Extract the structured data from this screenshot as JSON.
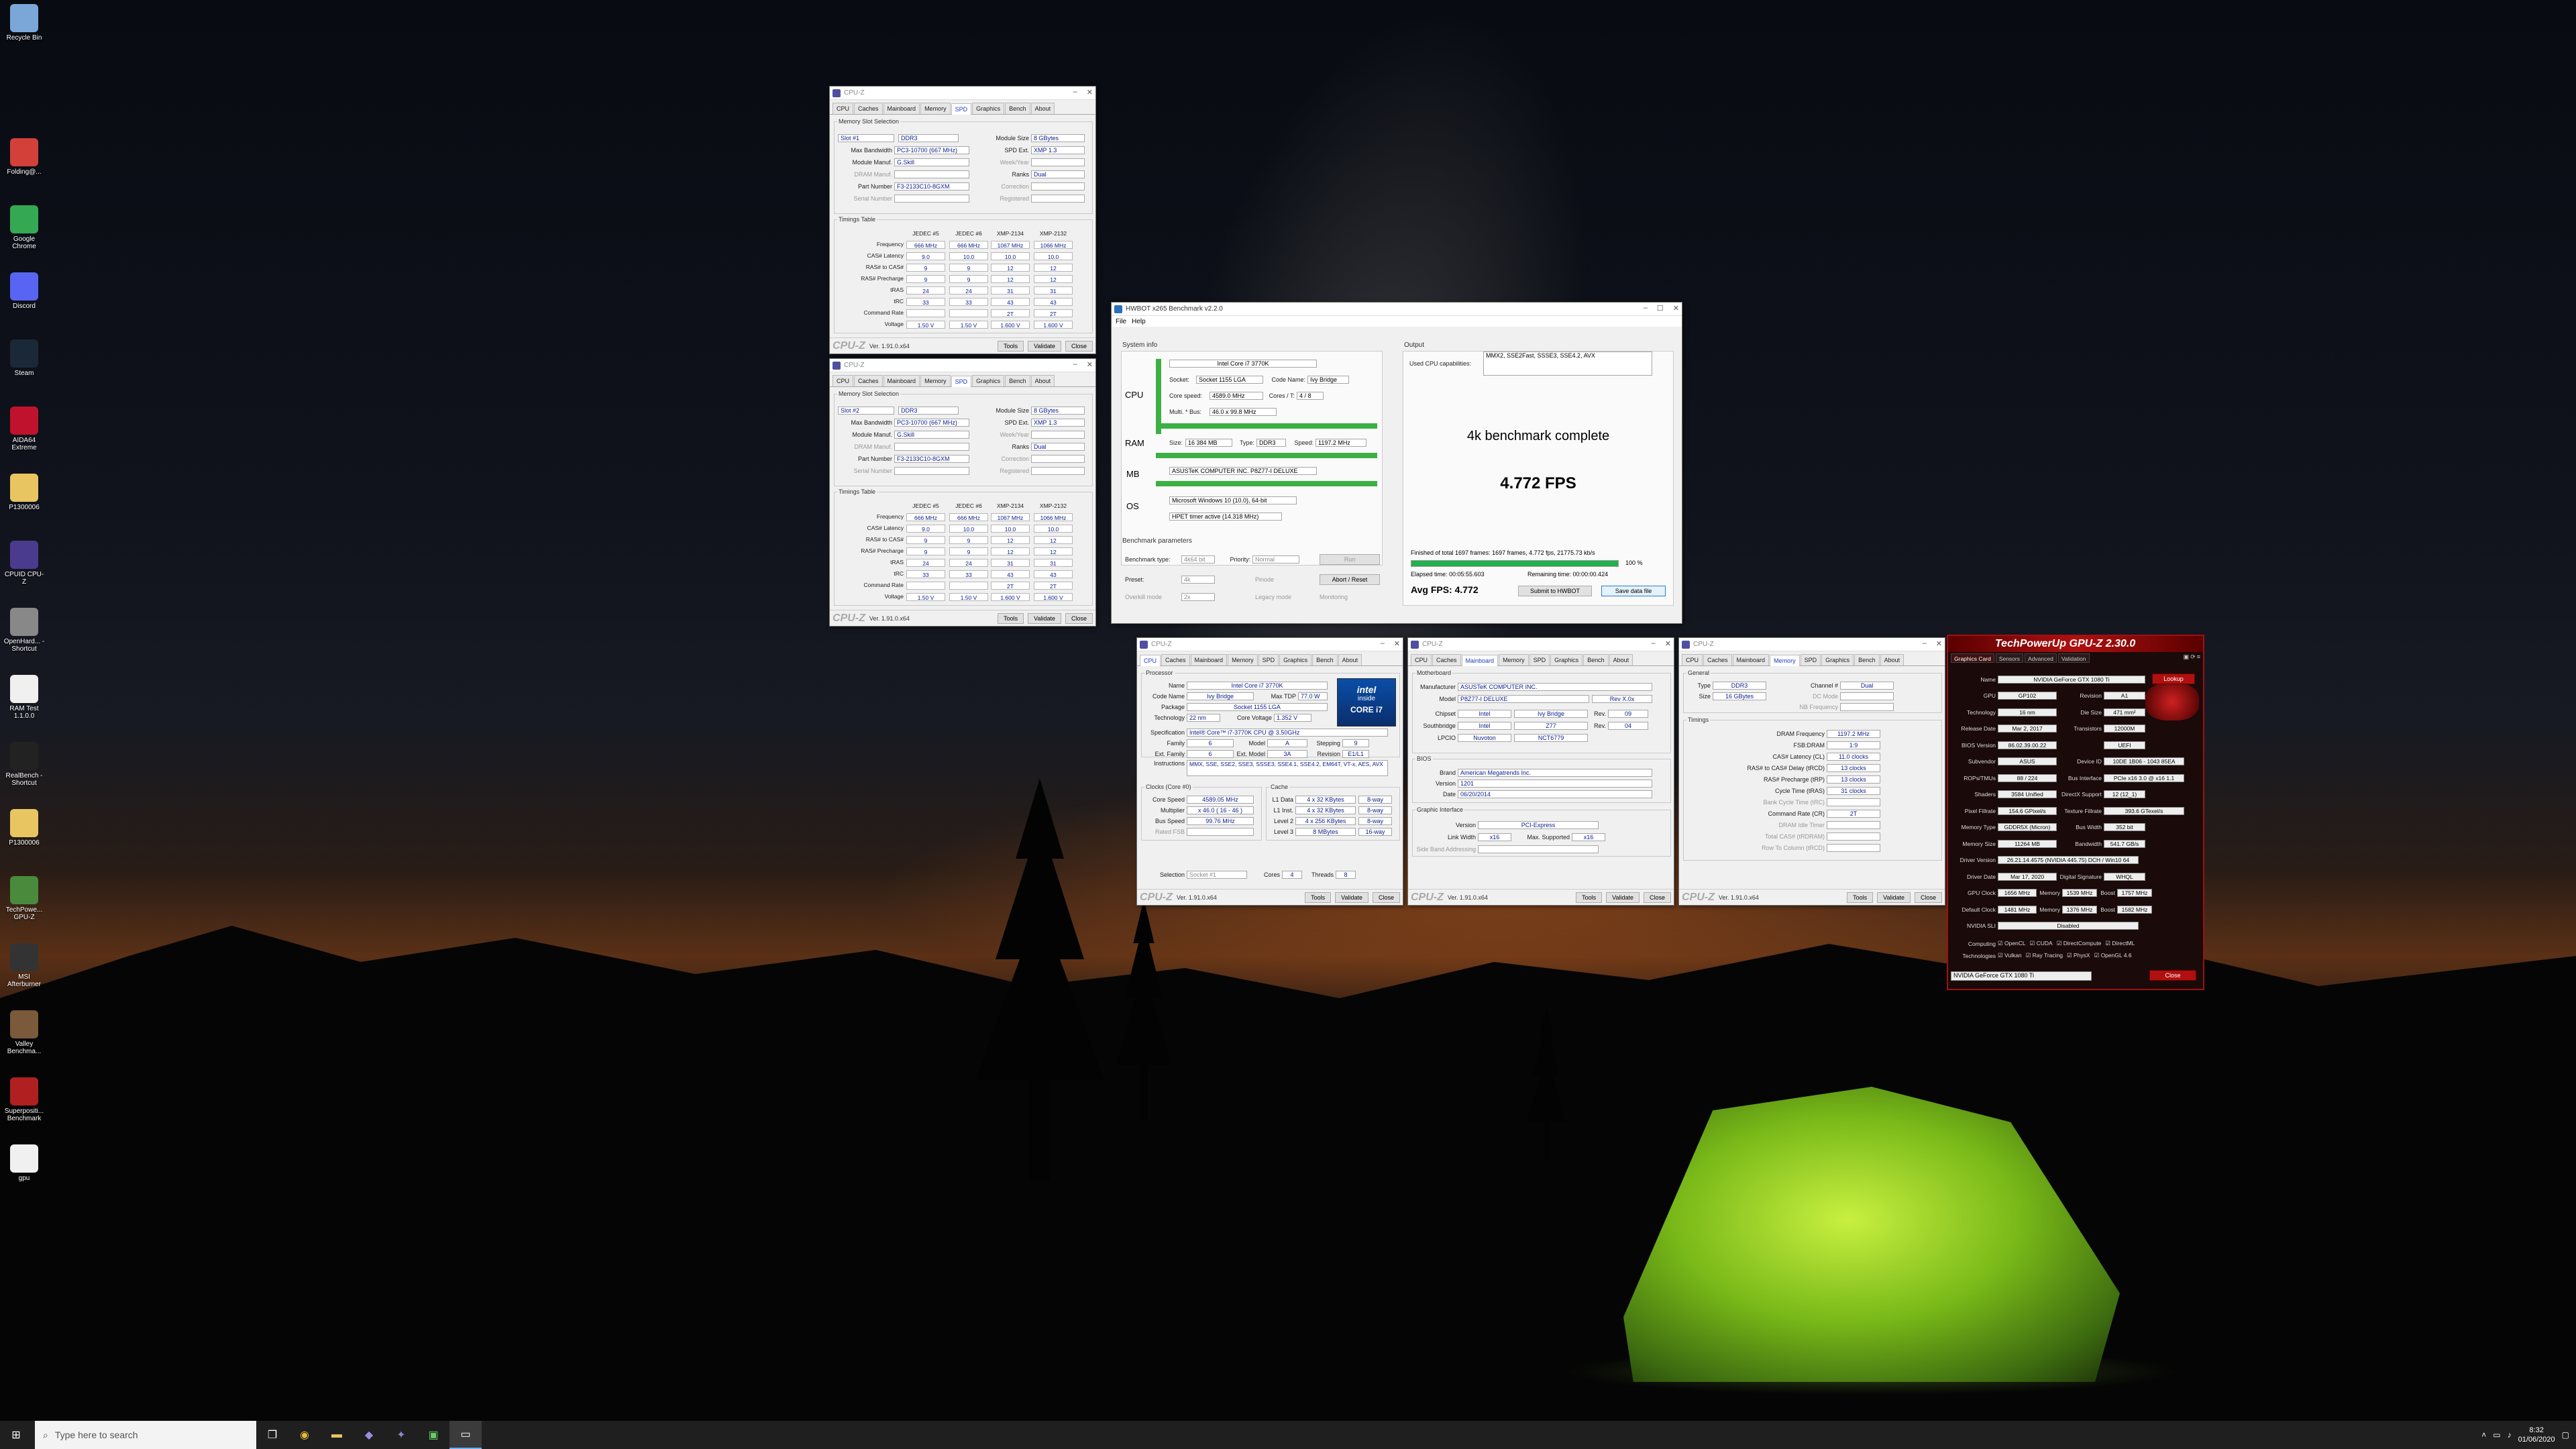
{
  "desktop": {
    "icons": [
      {
        "label": "Recycle Bin",
        "icon": "recycle-bin-icon",
        "color": "#7aa7d8"
      },
      {
        "label": "Folding@...",
        "icon": "folding-icon",
        "color": "#d2403a"
      },
      {
        "label": "Google Chrome",
        "icon": "chrome-icon",
        "color": "#34a853"
      },
      {
        "label": "Discord",
        "icon": "discord-icon",
        "color": "#5865f2"
      },
      {
        "label": "Steam",
        "icon": "steam-icon",
        "color": "#1b2838"
      },
      {
        "label": "AIDA64 Extreme",
        "icon": "aida64-icon",
        "color": "#c0122d"
      },
      {
        "label": "P1300006",
        "icon": "folder-icon",
        "color": "#e8c560"
      },
      {
        "label": "CPUID CPU-Z",
        "icon": "cpuz-icon",
        "color": "#4b3b8f"
      },
      {
        "label": "OpenHard... - Shortcut",
        "icon": "openhardware-icon",
        "color": "#888888"
      },
      {
        "label": "RAM Test 1.1.0.0",
        "icon": "document-icon",
        "color": "#f0f0f0"
      },
      {
        "label": "RealBench - Shortcut",
        "icon": "realbench-icon",
        "color": "#222222"
      },
      {
        "label": "P1300006",
        "icon": "folder-icon",
        "color": "#e8c560"
      },
      {
        "label": "TechPowe... GPU-Z",
        "icon": "gpuz-icon",
        "color": "#4a8a3c"
      },
      {
        "label": "MSI Afterburner",
        "icon": "afterburner-icon",
        "color": "#333333"
      },
      {
        "label": "Valley Benchma...",
        "icon": "valley-icon",
        "color": "#7a5a3a"
      },
      {
        "label": "Superpositi... Benchmark",
        "icon": "superposition-icon",
        "color": "#b02020"
      },
      {
        "label": "gpu",
        "icon": "document-icon",
        "color": "#f0f0f0"
      }
    ]
  },
  "cpuz_spd1": {
    "title": "CPU-Z",
    "tabs": [
      "CPU",
      "Caches",
      "Mainboard",
      "Memory",
      "SPD",
      "Graphics",
      "Bench",
      "About"
    ],
    "active_tab": "SPD",
    "slot_group": "Memory Slot Selection",
    "slot": "Slot #1",
    "type": "DDR3",
    "module_size_label": "Module Size",
    "module_size": "8 GBytes",
    "max_bw_label": "Max Bandwidth",
    "max_bw": "PC3-10700 (667 MHz)",
    "spd_ext_label": "SPD Ext.",
    "spd_ext": "XMP 1.3",
    "manuf_label": "Module Manuf.",
    "manuf": "G.Skill",
    "weekyear_label": "Week/Year",
    "dram_manuf_label": "DRAM Manuf.",
    "ranks_label": "Ranks",
    "ranks": "Dual",
    "part_label": "Part Number",
    "part": "F3-2133C10-8GXM",
    "correction_label": "Correction",
    "serial_label": "Serial Number",
    "registered_label": "Registered",
    "timings_group": "Timings Table",
    "cols": [
      "JEDEC #5",
      "JEDEC #6",
      "XMP-2134",
      "XMP-2132"
    ],
    "rows": [
      {
        "label": "Frequency",
        "vals": [
          "666 MHz",
          "666 MHz",
          "1067 MHz",
          "1066 MHz"
        ]
      },
      {
        "label": "CAS# Latency",
        "vals": [
          "9.0",
          "10.0",
          "10.0",
          "10.0"
        ]
      },
      {
        "label": "RAS# to CAS#",
        "vals": [
          "9",
          "9",
          "12",
          "12"
        ]
      },
      {
        "label": "RAS# Precharge",
        "vals": [
          "9",
          "9",
          "12",
          "12"
        ]
      },
      {
        "label": "tRAS",
        "vals": [
          "24",
          "24",
          "31",
          "31"
        ]
      },
      {
        "label": "tRC",
        "vals": [
          "33",
          "33",
          "43",
          "43"
        ]
      },
      {
        "label": "Command Rate",
        "vals": [
          "",
          "",
          "2T",
          "2T"
        ]
      },
      {
        "label": "Voltage",
        "vals": [
          "1.50 V",
          "1.50 V",
          "1.600 V",
          "1.600 V"
        ]
      }
    ],
    "brand": "CPU-Z",
    "version": "Ver. 1.91.0.x64",
    "tools": "Tools",
    "validate": "Validate",
    "close": "Close"
  },
  "cpuz_spd2": {
    "title": "CPU-Z",
    "tabs": [
      "CPU",
      "Caches",
      "Mainboard",
      "Memory",
      "SPD",
      "Graphics",
      "Bench",
      "About"
    ],
    "slot_group": "Memory Slot Selection",
    "slot": "Slot #2",
    "type": "DDR3",
    "module_size_label": "Module Size",
    "module_size": "8 GBytes",
    "max_bw_label": "Max Bandwidth",
    "max_bw": "PC3-10700 (667 MHz)",
    "spd_ext_label": "SPD Ext.",
    "spd_ext": "XMP 1.3",
    "manuf_label": "Module Manuf.",
    "manuf": "G.Skill",
    "weekyear_label": "Week/Year",
    "dram_manuf_label": "DRAM Manuf.",
    "ranks_label": "Ranks",
    "ranks": "Dual",
    "part_label": "Part Number",
    "part": "F3-2133C10-8GXM",
    "correction_label": "Correction",
    "serial_label": "Serial Number",
    "registered_label": "Registered",
    "timings_group": "Timings Table",
    "cols": [
      "JEDEC #5",
      "JEDEC #6",
      "XMP-2134",
      "XMP-2132"
    ],
    "rows": [
      {
        "label": "Frequency",
        "vals": [
          "666 MHz",
          "666 MHz",
          "1067 MHz",
          "1066 MHz"
        ]
      },
      {
        "label": "CAS# Latency",
        "vals": [
          "9.0",
          "10.0",
          "10.0",
          "10.0"
        ]
      },
      {
        "label": "RAS# to CAS#",
        "vals": [
          "9",
          "9",
          "12",
          "12"
        ]
      },
      {
        "label": "RAS# Precharge",
        "vals": [
          "9",
          "9",
          "12",
          "12"
        ]
      },
      {
        "label": "tRAS",
        "vals": [
          "24",
          "24",
          "31",
          "31"
        ]
      },
      {
        "label": "tRC",
        "vals": [
          "33",
          "33",
          "43",
          "43"
        ]
      },
      {
        "label": "Command Rate",
        "vals": [
          "",
          "",
          "2T",
          "2T"
        ]
      },
      {
        "label": "Voltage",
        "vals": [
          "1.50 V",
          "1.50 V",
          "1.600 V",
          "1.600 V"
        ]
      }
    ],
    "brand": "CPU-Z",
    "version": "Ver. 1.91.0.x64",
    "tools": "Tools",
    "validate": "Validate",
    "close": "Close"
  },
  "hwbot": {
    "title": "HWBOT x265 Benchmark v2.2.0",
    "menu": [
      "File",
      "Help"
    ],
    "sysinfo_label": "System info",
    "cpu_name": "Intel Core i7 3770K",
    "socket_label": "Socket:",
    "socket": "Socket 1155 LGA",
    "codename_label": "Code Name:",
    "codename": "Ivy Bridge",
    "corespeed_label": "Core speed:",
    "corespeed": "4589.0 MHz",
    "cores_label": "Cores / T:",
    "cores": "4 / 8",
    "mult_label": "Multi. * Bus:",
    "mult": "46.0 x 99.8 MHz",
    "cpu_tag": "CPU",
    "ram_tag": "RAM",
    "mb_tag": "MB",
    "os_tag": "OS",
    "ram_size_label": "Size:",
    "ram_size": "16 384 MB",
    "ram_type_label": "Type:",
    "ram_type": "DDR3",
    "ram_speed_label": "Speed:",
    "ram_speed": "1197.2 MHz",
    "mb": "ASUSTeK COMPUTER INC. P8Z77-I DELUXE",
    "os": "Microsoft Windows 10 (10.0), 64-bit",
    "timer": "HPET timer active (14.318 MHz)",
    "bench_params_label": "Benchmark parameters",
    "bench_type_label": "Benchmark type:",
    "bench_type": "4k64 bit",
    "priority_label": "Priority:",
    "priority": "Normal",
    "run_label": "Run",
    "preset_label": "Preset:",
    "preset": "4k",
    "pinode_label": "Pinode",
    "abort_label": "Abort / Reset",
    "overkill_label": "Overkill mode",
    "overkill_val": "2x",
    "legacy_label": "Legacy mode",
    "monitoring_label": "Monitoring",
    "output_label": "Output",
    "capabilities_label": "Used CPU capabilities:",
    "capabilities": "MMX2, SSE2Fast, SSSE3, SSE4.2, AVX",
    "complete": "4k benchmark complete",
    "fps": "4.772 FPS",
    "finished": "Finished of total 1697 frames: 1697 frames, 4.772 fps, 21775.73 kb/s",
    "percent": "100 %",
    "progress": 1.0,
    "elapsed": "Elapsed time: 00:05:55.603",
    "remaining": "Remaining time: 00:00:00.424",
    "avg": "Avg FPS: 4.772",
    "submit": "Submit to HWBOT",
    "save": "Save data file"
  },
  "cpuz_cpu": {
    "title": "CPU-Z",
    "tabs": [
      "CPU",
      "Caches",
      "Mainboard",
      "Memory",
      "SPD",
      "Graphics",
      "Bench",
      "About"
    ],
    "processor_group": "Processor",
    "name_label": "Name",
    "name": "Intel Core i7 3770K",
    "codename_label": "Code Name",
    "codename": "Ivy Bridge",
    "maxtdp_label": "Max TDP",
    "maxtdp": "77.0 W",
    "package_label": "Package",
    "package": "Socket 1155 LGA",
    "tech_label": "Technology",
    "tech": "22 nm",
    "corev_label": "Core Voltage",
    "corev": "1.352 V",
    "spec_label": "Specification",
    "spec": "Intel® Core™ i7-3770K CPU @ 3.50GHz",
    "family_label": "Family",
    "family": "6",
    "model_label": "Model",
    "model": "A",
    "stepping_label": "Stepping",
    "stepping": "9",
    "extfamily_label": "Ext. Family",
    "extfamily": "6",
    "extmodel_label": "Ext. Model",
    "extmodel": "3A",
    "revision_label": "Revision",
    "revision": "E1/L1",
    "instr_label": "Instructions",
    "instr": "MMX, SSE, SSE2, SSE3, SSSE3, SSE4.1, SSE4.2, EM64T, VT-x, AES, AVX",
    "clocks_group": "Clocks (Core #0)",
    "corespeed_label": "Core Speed",
    "corespeed": "4589.05 MHz",
    "mult_label": "Multiplier",
    "mult": "x 46.0 ( 16 - 46 )",
    "bus_label": "Bus Speed",
    "bus": "99.76 MHz",
    "fsb_label": "Rated FSB",
    "cache_group": "Cache",
    "l1d_label": "L1 Data",
    "l1d": "4 x 32 KBytes",
    "l1d_way": "8-way",
    "l1i_label": "L1 Inst.",
    "l1i": "4 x 32 KBytes",
    "l1i_way": "8-way",
    "l2_label": "Level 2",
    "l2": "4 x 256 KBytes",
    "l2_way": "8-way",
    "l3_label": "Level 3",
    "l3": "8 MBytes",
    "l3_way": "16-way",
    "selection_label": "Selection",
    "selection": "Socket #1",
    "cores_label": "Cores",
    "cores": "4",
    "threads_label": "Threads",
    "threads": "8",
    "intel_badge_top": "intel",
    "intel_badge_mid": "inside",
    "intel_badge_bottom": "CORE i7",
    "brand": "CPU-Z",
    "version": "Ver. 1.91.0.x64",
    "tools": "Tools",
    "validate": "Validate",
    "close": "Close"
  },
  "cpuz_mb": {
    "title": "CPU-Z",
    "tabs": [
      "CPU",
      "Caches",
      "Mainboard",
      "Memory",
      "SPD",
      "Graphics",
      "Bench",
      "About"
    ],
    "mb_group": "Motherboard",
    "manuf_label": "Manufacturer",
    "manuf": "ASUSTeK COMPUTER INC.",
    "model_label": "Model",
    "model": "P8Z77-I DELUXE",
    "model_rev": "Rev X.0x",
    "chipset_label": "Chipset",
    "chipset": "Intel",
    "chipset_name": "Ivy Bridge",
    "chipset_rev_label": "Rev.",
    "chipset_rev": "09",
    "south_label": "Southbridge",
    "south": "Intel",
    "south_name": "Z77",
    "south_rev_label": "Rev.",
    "south_rev": "04",
    "lpcio_label": "LPCIO",
    "lpcio": "Nuvoton",
    "lpcio_name": "NCT6779",
    "bios_group": "BIOS",
    "brand_label": "Brand",
    "brand_val": "American Megatrends Inc.",
    "version_label": "Version",
    "version_val": "1201",
    "date_label": "Date",
    "date_val": "06/20/2014",
    "gi_group": "Graphic Interface",
    "gi_version_label": "Version",
    "gi_version": "PCI-Express",
    "linkwidth_label": "Link Width",
    "linkwidth": "x16",
    "maxsupp_label": "Max. Supported",
    "maxsupp": "x16",
    "sideband_label": "Side Band Addressing",
    "brand": "CPU-Z",
    "version": "Ver. 1.91.0.x64",
    "tools": "Tools",
    "validate": "Validate",
    "close": "Close"
  },
  "cpuz_mem": {
    "title": "CPU-Z",
    "tabs": [
      "CPU",
      "Caches",
      "Mainboard",
      "Memory",
      "SPD",
      "Graphics",
      "Bench",
      "About"
    ],
    "general_group": "General",
    "type_label": "Type",
    "type": "DDR3",
    "channel_label": "Channel #",
    "channel": "Dual",
    "size_label": "Size",
    "size": "16 GBytes",
    "dcmode_label": "DC Mode",
    "nbfreq_label": "NB Frequency",
    "timings_group": "Timings",
    "rows": [
      {
        "label": "DRAM Frequency",
        "val": "1197.2 MHz",
        "dim": false
      },
      {
        "label": "FSB:DRAM",
        "val": "1:9",
        "dim": false
      },
      {
        "label": "CAS# Latency (CL)",
        "val": "11.0 clocks",
        "dim": false
      },
      {
        "label": "RAS# to CAS# Delay (tRCD)",
        "val": "13 clocks",
        "dim": false
      },
      {
        "label": "RAS# Precharge (tRP)",
        "val": "13 clocks",
        "dim": false
      },
      {
        "label": "Cycle Time (tRAS)",
        "val": "31 clocks",
        "dim": false
      },
      {
        "label": "Bank Cycle Time (tRC)",
        "val": "",
        "dim": true
      },
      {
        "label": "Command Rate (CR)",
        "val": "2T",
        "dim": false
      },
      {
        "label": "DRAM Idle Timer",
        "val": "",
        "dim": true
      },
      {
        "label": "Total CAS# (tRDRAM)",
        "val": "",
        "dim": true
      },
      {
        "label": "Row To Column (tRCD)",
        "val": "",
        "dim": true
      }
    ],
    "brand": "CPU-Z",
    "version": "Ver. 1.91.0.x64",
    "tools": "Tools",
    "validate": "Validate",
    "close": "Close"
  },
  "gpuz": {
    "title": "TechPowerUp GPU-Z 2.30.0",
    "tabs": [
      "Graphics Card",
      "Sensors",
      "Advanced",
      "Validation"
    ],
    "lookup": "Lookup",
    "rows": [
      {
        "label": "Name",
        "v1": "NVIDIA GeForce GTX 1080 Ti"
      },
      {
        "label": "GPU",
        "v1": "GP102",
        "l2": "Revision",
        "v2": "A1"
      },
      {
        "label": "Technology",
        "v1": "16 nm",
        "l2": "Die Size",
        "v2": "471 mm²"
      },
      {
        "label": "Release Date",
        "v1": "Mar 2, 2017",
        "l2": "Transistors",
        "v2": "12000M"
      },
      {
        "label": "BIOS Version",
        "v1": "86.02.39.00.22",
        "l2": "",
        "v2": "UEFI"
      },
      {
        "label": "Subvendor",
        "v1": "ASUS",
        "l2": "Device ID",
        "v2": "10DE 1B06 - 1043 85EA"
      },
      {
        "label": "ROPs/TMUs",
        "v1": "88 / 224",
        "l2": "Bus Interface",
        "v2": "PCIe x16 3.0 @ x16 1.1"
      },
      {
        "label": "Shaders",
        "v1": "3584 Unified",
        "l2": "DirectX Support",
        "v2": "12 (12_1)"
      },
      {
        "label": "Pixel Fillrate",
        "v1": "154.6 GPixel/s",
        "l2": "Texture Fillrate",
        "v2": "393.6 GTexel/s"
      },
      {
        "label": "Memory Type",
        "v1": "GDDR5X (Micron)",
        "l2": "Bus Width",
        "v2": "352 bit"
      },
      {
        "label": "Memory Size",
        "v1": "11264 MB",
        "l2": "Bandwidth",
        "v2": "541.7 GB/s"
      },
      {
        "label": "Driver Version",
        "v1": "26.21.14.4575 (NVIDIA 445.75) DCH / Win10 64"
      },
      {
        "label": "Driver Date",
        "v1": "Mar 17, 2020",
        "l2": "Digital Signature",
        "v2": "WHQL"
      },
      {
        "label": "GPU Clock",
        "v1": "1656 MHz",
        "l2": "Memory",
        "v2": "1539 MHz",
        "l3": "Boost",
        "v3": "1757 MHz"
      },
      {
        "label": "Default Clock",
        "v1": "1481 MHz",
        "l2": "Memory",
        "v2": "1376 MHz",
        "l3": "Boost",
        "v3": "1582 MHz"
      },
      {
        "label": "NVIDIA SLI",
        "v1": "Disabled"
      }
    ],
    "computing_label": "Computing",
    "computing": [
      "OpenCL",
      "CUDA",
      "DirectCompute",
      "DirectML"
    ],
    "technologies_label": "Technologies",
    "technologies": [
      "Vulkan",
      "Ray Tracing",
      "PhysX",
      "OpenGL 4.6"
    ],
    "select": "NVIDIA GeForce GTX 1080 Ti",
    "close": "Close"
  },
  "taskbar": {
    "search_placeholder": "Type here to search",
    "time": "8:32",
    "date": "01/06/2020"
  }
}
